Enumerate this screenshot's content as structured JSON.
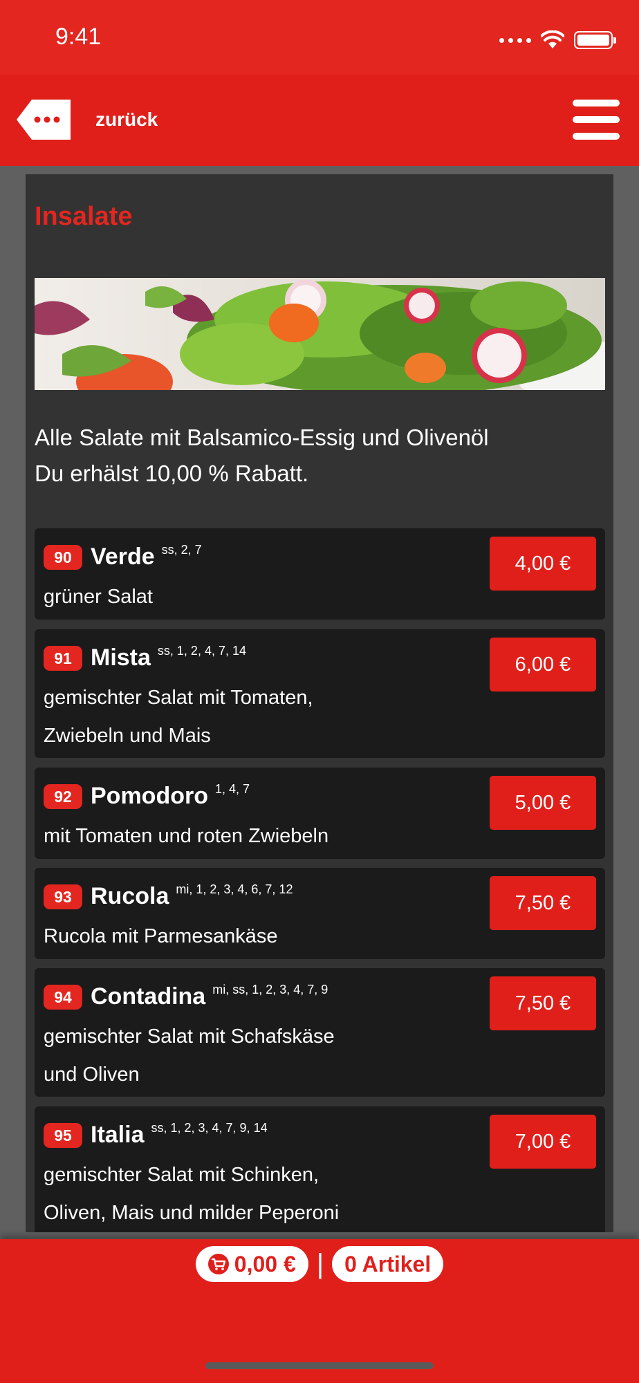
{
  "status_bar": {
    "time": "9:41"
  },
  "nav": {
    "back_label": "zurück"
  },
  "section": {
    "title": "Insalate",
    "description_line1": "Alle Salate mit Balsamico-Essig und Olivenöl",
    "description_line2": "Du erhälst 10,00 % Rabatt."
  },
  "items": [
    {
      "number": "90",
      "name": "Verde",
      "allergens": "ss, 2, 7",
      "desc1": "grüner Salat",
      "desc2": "",
      "price": "4,00 €"
    },
    {
      "number": "91",
      "name": "Mista",
      "allergens": "ss, 1, 2, 4, 7, 14",
      "desc1": "gemischter Salat mit Tomaten,",
      "desc2": "Zwiebeln und Mais",
      "price": "6,00 €"
    },
    {
      "number": "92",
      "name": "Pomodoro",
      "allergens": "1, 4, 7",
      "desc1": "mit Tomaten und roten Zwiebeln",
      "desc2": "",
      "price": "5,00 €"
    },
    {
      "number": "93",
      "name": "Rucola",
      "allergens": "mi, 1, 2, 3, 4, 6, 7, 12",
      "desc1": "Rucola mit Parmesankäse",
      "desc2": "",
      "price": "7,50 €"
    },
    {
      "number": "94",
      "name": "Contadina",
      "allergens": "mi, ss, 1, 2, 3, 4, 7, 9",
      "desc1": "gemischter Salat mit Schafskäse",
      "desc2": "und Oliven",
      "price": "7,50 €"
    },
    {
      "number": "95",
      "name": "Italia",
      "allergens": "ss, 1, 2, 3, 4, 7, 9, 14",
      "desc1": "gemischter Salat mit Schinken,",
      "desc2": "Oliven, Mais und milder Peperoni",
      "price": "7,00 €"
    }
  ],
  "cart": {
    "total": "0,00 €",
    "separator": "|",
    "articles": "0 Artikel"
  },
  "colors": {
    "brand_red": "#e01f1b",
    "panel": "#333333",
    "item_bg": "#1b1b1b"
  },
  "icons": [
    "back-arrow-icon",
    "menu-icon",
    "cart-icon",
    "wifi-icon",
    "battery-icon",
    "signal-icon"
  ]
}
